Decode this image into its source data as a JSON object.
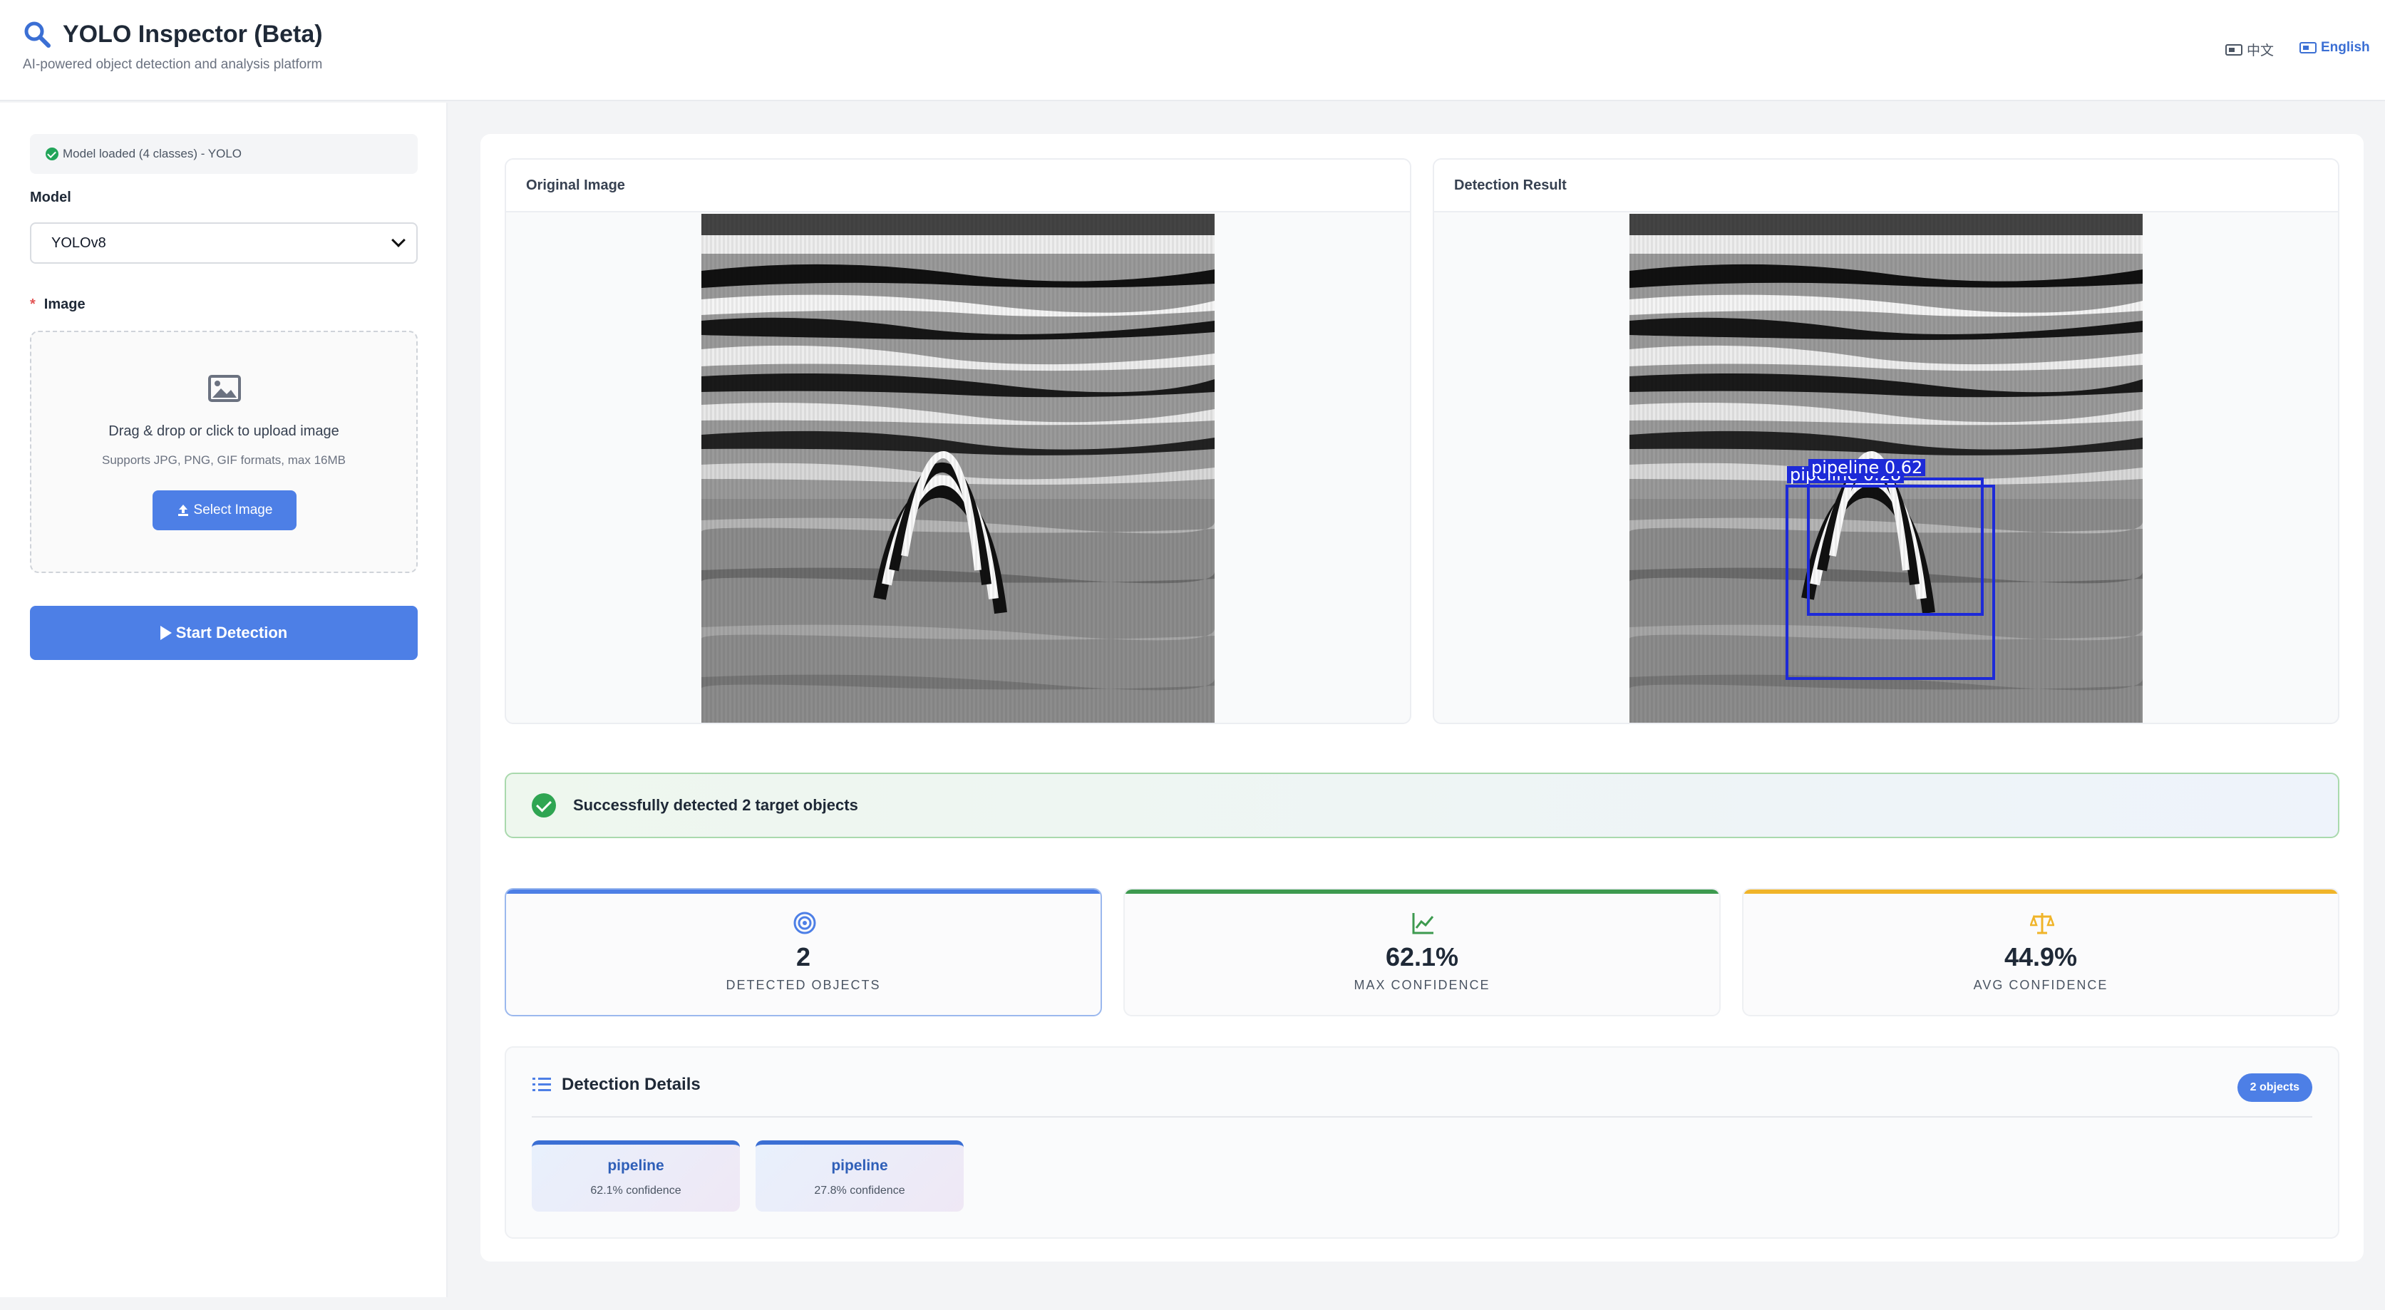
{
  "app": {
    "title": "YOLO Inspector  (Beta)",
    "subtitle": "AI-powered object detection and analysis platform",
    "lang_zh": "中文",
    "lang_en": "English"
  },
  "sidebar": {
    "status": "Model loaded (4 classes) - YOLO",
    "model_label": "Model",
    "model_value": "YOLOv8",
    "image_label": "Image",
    "required_mark": "*",
    "upload_title": "Drag & drop or click to upload image",
    "upload_hint": "Supports JPG, PNG, GIF formats, max 16MB",
    "select_button": "Select Image",
    "start_button": "Start Detection"
  },
  "images": {
    "original_title": "Original Image",
    "result_title": "Detection Result",
    "box_labels": [
      "pipeline  0.62",
      "pipeline  0.28"
    ]
  },
  "alert": "Successfully detected 2 target objects",
  "stats": [
    {
      "value": "2",
      "caption": "DETECTED OBJECTS",
      "icon": "target-icon",
      "color": "#4d7fe6"
    },
    {
      "value": "62.1%",
      "caption": "MAX CONFIDENCE",
      "icon": "chart-line-icon",
      "color": "#3d9a4f"
    },
    {
      "value": "44.9%",
      "caption": "AVG CONFIDENCE",
      "icon": "balance-scale-icon",
      "color": "#f0b429"
    }
  ],
  "details": {
    "title": "Detection Details",
    "count_badge": "2 objects",
    "items": [
      {
        "name": "pipeline",
        "confidence": "62.1% confidence"
      },
      {
        "name": "pipeline",
        "confidence": "27.8% confidence"
      }
    ]
  }
}
